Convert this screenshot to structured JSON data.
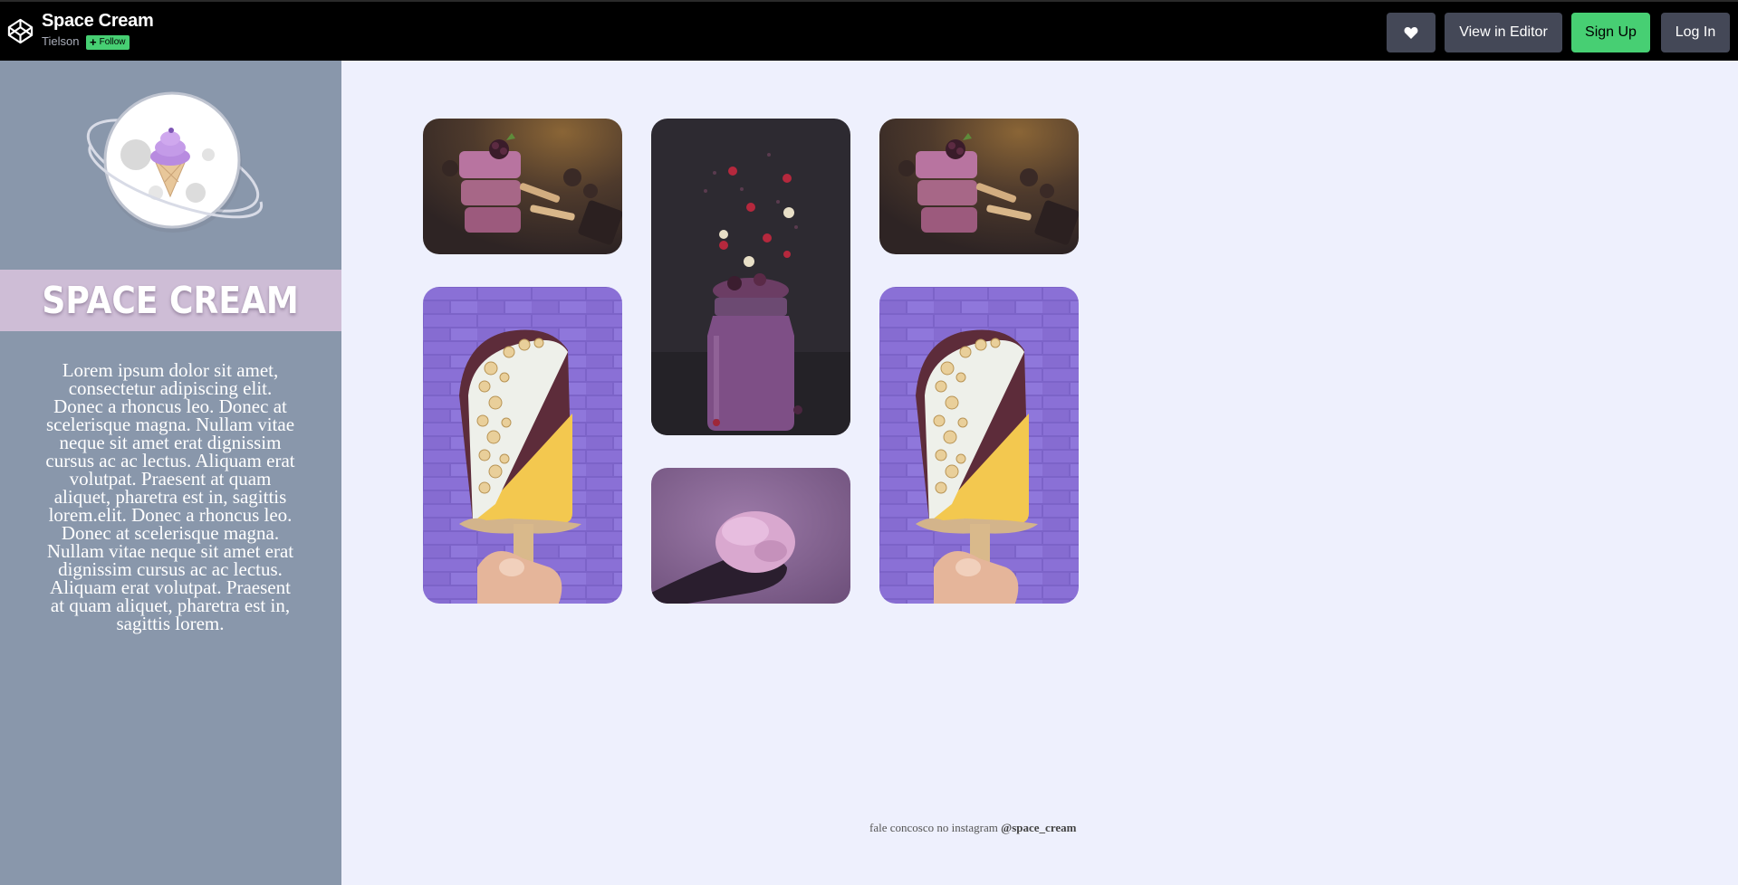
{
  "header": {
    "pen_title": "Space Cream",
    "author": "Tielson",
    "follow_label": "Follow",
    "buttons": {
      "heart_icon": "heart-icon",
      "view_in_editor": "View in Editor",
      "sign_up": "Sign Up",
      "log_in": "Log In"
    }
  },
  "sidebar": {
    "title": "SPACE CREAM",
    "description": "Lorem ipsum dolor sit amet, consectetur adipiscing elit. Donec a rhoncus leo. Donec at scelerisque magna. Nullam vitae neque sit amet erat dignissim cursus ac ac lectus. Aliquam erat volutpat. Praesent at quam aliquet, pharetra est in, sagittis lorem.elit. Donec a rhoncus leo. Donec at scelerisque magna. Nullam vitae neque sit amet erat dignissim cursus ac ac lectus. Aliquam erat volutpat. Praesent at quam aliquet, pharetra est in, sagittis lorem."
  },
  "footer": {
    "text": "fale concosco no instagram",
    "handle": "@space_cream"
  },
  "colors": {
    "topbar": "#000000",
    "editor_button": "#444857",
    "signup_button": "#47cf73",
    "sidebar": "#8997ab",
    "title_band": "#cebdd6",
    "preview_background": "#eef0fd"
  }
}
